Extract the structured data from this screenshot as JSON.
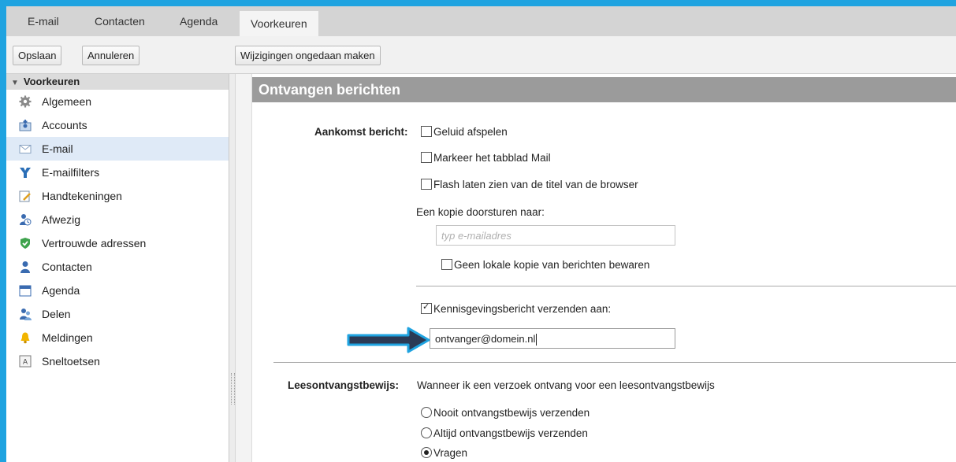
{
  "tabs": [
    "E-mail",
    "Contacten",
    "Agenda",
    "Voorkeuren"
  ],
  "toolbar": {
    "save": "Opslaan",
    "cancel": "Annuleren",
    "undo": "Wijzigingen ongedaan maken"
  },
  "sidebar": {
    "header": "Voorkeuren",
    "items": [
      {
        "label": "Algemeen",
        "icon": "gear-icon"
      },
      {
        "label": "Accounts",
        "icon": "accounts-icon"
      },
      {
        "label": "E-mail",
        "icon": "mail-icon"
      },
      {
        "label": "E-mailfilters",
        "icon": "filter-icon"
      },
      {
        "label": "Handtekeningen",
        "icon": "signature-icon"
      },
      {
        "label": "Afwezig",
        "icon": "away-icon"
      },
      {
        "label": "Vertrouwde adressen",
        "icon": "shield-icon"
      },
      {
        "label": "Contacten",
        "icon": "contact-icon"
      },
      {
        "label": "Agenda",
        "icon": "calendar-icon"
      },
      {
        "label": "Delen",
        "icon": "share-icon"
      },
      {
        "label": "Meldingen",
        "icon": "bell-icon"
      },
      {
        "label": "Sneltoetsen",
        "icon": "keyboard-icon"
      }
    ],
    "selected": "E-mail"
  },
  "section": {
    "title": "Ontvangen berichten",
    "arrival_label": "Aankomst bericht:",
    "opt_sound": "Geluid afspelen",
    "opt_mark_tab": "Markeer het tabblad Mail",
    "opt_flash": "Flash laten zien van de titel van de browser",
    "forward_label": "Een kopie doorsturen naar:",
    "forward_placeholder": "typ e-mailadres",
    "no_local_copy": "Geen lokale kopie van berichten bewaren",
    "notify_label": "Kennisgevingsbericht verzenden aan:",
    "notify_value": "ontvanger@domein.nl",
    "receipt_label": "Leesontvangstbewijs:",
    "receipt_desc": "Wanneer ik een verzoek ontvang voor een leesontvangstbewijs",
    "receipt_never": "Nooit ontvangstbewijs verzenden",
    "receipt_always": "Altijd ontvangstbewijs verzenden",
    "receipt_ask": "Vragen"
  },
  "colors": {
    "frame_border": "#1fa3e0",
    "section_header": "#9b9b9b",
    "arrow_fill": "#2b3a55",
    "arrow_outline": "#1fa3e0"
  }
}
